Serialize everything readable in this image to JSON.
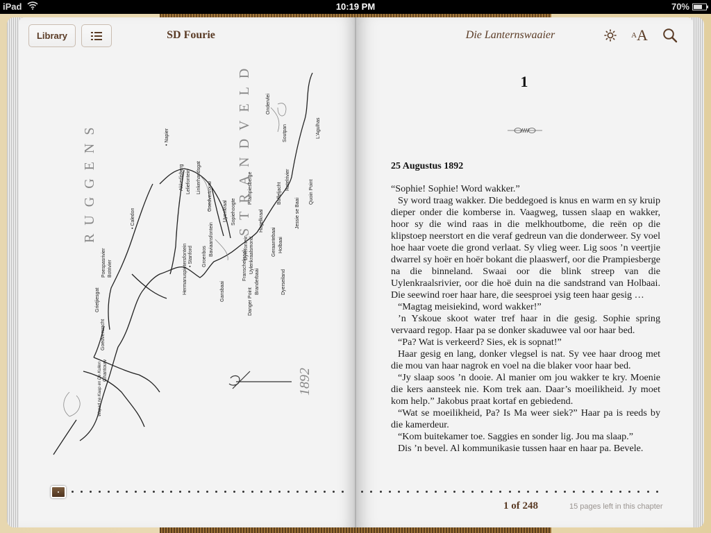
{
  "status_bar": {
    "device": "iPad",
    "time": "10:19 PM",
    "battery_percent_label": "70%",
    "battery_level": 0.7
  },
  "toolbar": {
    "library_label": "Library",
    "toc_icon": "list-icon",
    "author": "SD Fourie",
    "book_title": "Die Lanternswaaier",
    "brightness_icon": "brightness-icon",
    "font_size_small": "A",
    "font_size_large": "A",
    "search_icon": "search-icon"
  },
  "map": {
    "region_labels": [
      "RUGGENS",
      "STRANDVELD"
    ],
    "year": "1892",
    "places": [
      "Caledon",
      "Napier",
      "Akkedisberg",
      "Leliefontein",
      "Linkerhandsgat",
      "Goedvertrouw",
      "Nieuwehaal",
      "Uyenkraal",
      "Sopiehoogte",
      "Prampiesberge",
      "Hagelkraal",
      "Buffeljacht",
      "Ratelrivier",
      "Soutpan",
      "Ondervlei",
      "L'Agulhas",
      "Quoin Point",
      "Jessie se Baai",
      "Holbaai",
      "Geraantebaai",
      "Uylenkraalsmond",
      "Dyrefontein",
      "Franschekraal",
      "Baviaansfontein",
      "Groenbos",
      "Stanford",
      "Kleinrivier",
      "Hermanuspietersfontein",
      "Gansbaai",
      "Danger Point",
      "Branderbaai",
      "Dyerseiland",
      "Birkenhead",
      "Poespasrivier",
      "Botrivier",
      "Grietjiesgat",
      "Goedverwacht",
      "Ghantouw",
      "Wapad na Kaap en De Kuilen"
    ]
  },
  "chapter": {
    "number": "1",
    "date": "25 Augustus 1892",
    "paragraphs": [
      "“Sophie! Sophie! Word wakker.”",
      "Sy word traag wakker. Die beddegoed is knus en warm en sy kruip dieper onder die komberse in. Vaagweg, tussen slaap en wakker, hoor sy die wind raas in die melkhoutbome, die reën op die klipstoep neerstort en die veraf gedreun van die donderweer. Sy voel hoe haar voete die grond verlaat. Sy vlieg weer. Lig soos ’n veertjie dwarrel sy hoër en hoër bokant die plaaswerf, oor die Prampiesberge na die binneland. Swaai oor die blink streep van die Uylenkraalsrivier, oor die hoë duin na die sandstrand van Holbaai. Die seewind roer haar hare, die seesproei ysig teen haar gesig …",
      "“Magtag meisiekind, word wakker!”",
      "’n Yskoue skoot water tref haar in die gesig. Sophie spring vervaard regop. Haar pa se donker skaduwee val oor haar bed.",
      "“Pa? Wat is verkeerd? Sies, ek is sopnat!”",
      "Haar gesig en lang, donker vlegsel is nat. Sy vee haar droog met die mou van haar nagrok en voel na die blaker voor haar bed.",
      "“Jy slaap soos ’n dooie. Al manier om jou wakker te kry. Moenie die kers aansteek nie. Kom trek aan. Daar’s moeilikheid. Jy moet kom help.” Jakobus praat kortaf en gebiedend.",
      "“Wat se moeilikheid, Pa? Is Ma weer siek?” Haar pa is reeds by die kamerdeur.",
      "“Kom buitekamer toe. Saggies en sonder lig. Jou ma slaap.”",
      "Dis ’n bevel. Al kommunikasie tussen haar en haar pa. Bevele."
    ]
  },
  "footer": {
    "current_page": 1,
    "total_pages": 248,
    "page_label": "1 of 248",
    "pages_left_label": "15 pages left in this chapter"
  },
  "colors": {
    "accent_brown": "#5a3b25",
    "page": "#f3f3f3",
    "cover": "#e7d7b0"
  }
}
